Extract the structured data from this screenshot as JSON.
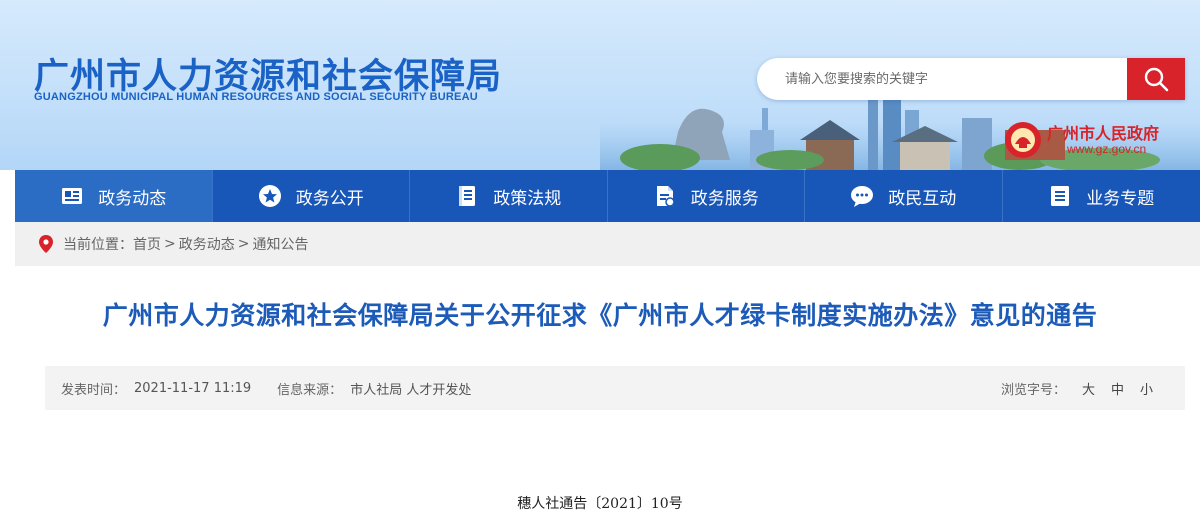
{
  "header": {
    "logo_cn": "广州市人力资源和社会保障局",
    "logo_en": "GUANGZHOU MUNICIPAL HUMAN RESOURCES AND SOCIAL SECURITY BUREAU",
    "search_placeholder": "请输入您要搜索的关键字",
    "gov_name": "广州市人民政府",
    "gov_url": "www.gz.gov.cn",
    "colors": {
      "brand_blue": "#1a62c6",
      "accent_red": "#d8232a"
    }
  },
  "nav": {
    "items": [
      {
        "label": "政务动态",
        "icon": "news-icon",
        "active": true
      },
      {
        "label": "政务公开",
        "icon": "star-circle-icon",
        "active": false
      },
      {
        "label": "政策法规",
        "icon": "book-icon",
        "active": false
      },
      {
        "label": "政务服务",
        "icon": "document-icon",
        "active": false
      },
      {
        "label": "政民互动",
        "icon": "chat-bubble-icon",
        "active": false
      },
      {
        "label": "业务专题",
        "icon": "list-icon",
        "active": false
      }
    ],
    "color": "#1856b8"
  },
  "breadcrumb": {
    "prefix": "当前位置：",
    "items": [
      "首页",
      "政务动态",
      "通知公告"
    ],
    "separator": ">"
  },
  "article": {
    "title": "广州市人力资源和社会保障局关于公开征求《广州市人才绿卡制度实施办法》意见的通告",
    "publish_label": "发表时间：",
    "publish_time": "2021-11-17 11:19",
    "source_label": "信息来源：",
    "source": "市人社局 人才开发处",
    "font_size_label": "浏览字号：",
    "font_sizes": [
      "大",
      "中",
      "小"
    ],
    "doc_number": "穗人社通告〔2021〕10号"
  }
}
